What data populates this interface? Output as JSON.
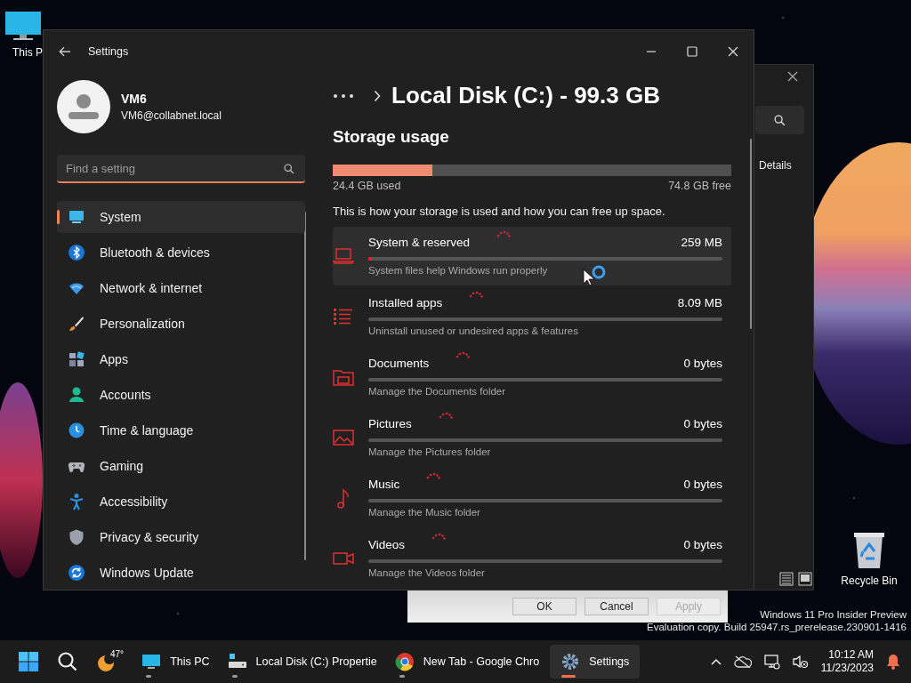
{
  "desktop": {
    "icons": [
      {
        "label": "This P",
        "kind": "pc"
      },
      {
        "label": "Recycle Bin",
        "kind": "bin"
      }
    ],
    "watermark": [
      "Windows 11 Pro Insider Preview",
      "Evaluation copy. Build 25947.rs_prerelease.230901-1416"
    ]
  },
  "background_windows": {
    "details_pane": {
      "tab": "Details"
    },
    "dialog": {
      "buttons": [
        {
          "label": "OK",
          "disabled": false
        },
        {
          "label": "Cancel",
          "disabled": false
        },
        {
          "label": "Apply",
          "disabled": true
        }
      ]
    }
  },
  "settings": {
    "title": "Settings",
    "account": {
      "name": "VM6",
      "email": "VM6@collabnet.local"
    },
    "search": {
      "placeholder": "Find a setting"
    },
    "nav": [
      {
        "label": "System",
        "kind": "system",
        "selected": true
      },
      {
        "label": "Bluetooth & devices",
        "kind": "bluetooth",
        "selected": false
      },
      {
        "label": "Network & internet",
        "kind": "network",
        "selected": false
      },
      {
        "label": "Personalization",
        "kind": "brush",
        "selected": false
      },
      {
        "label": "Apps",
        "kind": "apps",
        "selected": false
      },
      {
        "label": "Accounts",
        "kind": "accounts",
        "selected": false
      },
      {
        "label": "Time & language",
        "kind": "time",
        "selected": false
      },
      {
        "label": "Gaming",
        "kind": "gaming",
        "selected": false
      },
      {
        "label": "Accessibility",
        "kind": "accessibility",
        "selected": false
      },
      {
        "label": "Privacy & security",
        "kind": "shield",
        "selected": false
      },
      {
        "label": "Windows Update",
        "kind": "update",
        "selected": false
      }
    ],
    "breadcrumb": {
      "current": "Local Disk (C:) - 99.3 GB"
    },
    "storage": {
      "heading": "Storage usage",
      "level": 0.25,
      "used": "24.4 GB used",
      "free": "74.8 GB free",
      "description": "This is how your storage is used and how you can free up space.",
      "categories": [
        {
          "name": "System & reserved",
          "size": "259 MB",
          "level": 0.01,
          "description": "System files help Windows run properly",
          "kind": "laptop",
          "hovered": true
        },
        {
          "name": "Installed apps",
          "size": "8.09 MB",
          "level": 0,
          "description": "Uninstall unused or undesired apps & features",
          "kind": "apps",
          "hovered": false
        },
        {
          "name": "Documents",
          "size": "0 bytes",
          "level": 0,
          "description": "Manage the Documents folder",
          "kind": "folder",
          "hovered": false
        },
        {
          "name": "Pictures",
          "size": "0 bytes",
          "level": 0,
          "description": "Manage the Pictures folder",
          "kind": "pictures",
          "hovered": false
        },
        {
          "name": "Music",
          "size": "0 bytes",
          "level": 0,
          "description": "Manage the Music folder",
          "kind": "music",
          "hovered": false
        },
        {
          "name": "Videos",
          "size": "0 bytes",
          "level": 0,
          "description": "Manage the Videos folder",
          "kind": "video",
          "hovered": false
        }
      ]
    }
  },
  "taskbar": {
    "apps": [
      {
        "label": "This PC",
        "kind": "pc",
        "selected": false,
        "running": true
      },
      {
        "label": "Local Disk (C:) Propertie",
        "kind": "drive",
        "selected": false,
        "running": true
      },
      {
        "label": "New Tab - Google Chro",
        "kind": "browser",
        "selected": false,
        "running": true
      },
      {
        "label": "Settings",
        "kind": "gear",
        "selected": true,
        "running": true
      }
    ],
    "weather": "47°",
    "time": "10:12 AM",
    "date": "11/23/2023"
  }
}
